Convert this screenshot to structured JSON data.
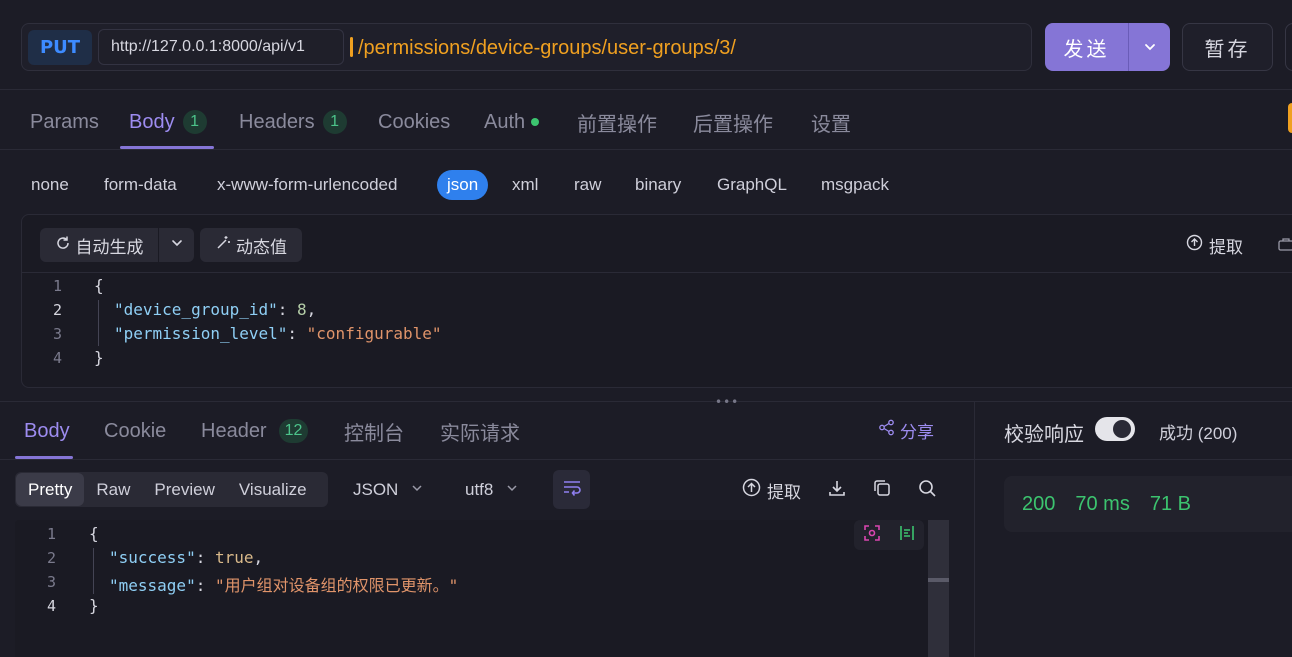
{
  "request": {
    "method": "PUT",
    "url_prefix": "http://127.0.0.1:8000/api/v1",
    "url_path": "/permissions/device-groups/user-groups/3/",
    "send_label": "发送",
    "save_label": "暂存"
  },
  "request_tabs": [
    {
      "label": "Params"
    },
    {
      "label": "Body",
      "badge": "1"
    },
    {
      "label": "Headers",
      "badge": "1"
    },
    {
      "label": "Cookies"
    },
    {
      "label": "Auth"
    },
    {
      "label": "前置操作"
    },
    {
      "label": "后置操作"
    },
    {
      "label": "设置"
    }
  ],
  "body_types": [
    "none",
    "form-data",
    "x-www-form-urlencoded",
    "json",
    "xml",
    "raw",
    "binary",
    "GraphQL",
    "msgpack"
  ],
  "editor_toolbar": {
    "auto_generate": "自动生成",
    "dynamic_value": "动态值",
    "extract": "提取"
  },
  "request_body": {
    "line_numbers": [
      "1",
      "2",
      "3",
      "4"
    ],
    "open": "{",
    "close": "}",
    "key1": "\"device_group_id\"",
    "val1": "8",
    "key2": "\"permission_level\"",
    "val2": "\"configurable\""
  },
  "response_tabs": [
    {
      "label": "Body"
    },
    {
      "label": "Cookie"
    },
    {
      "label": "Header",
      "badge": "12"
    },
    {
      "label": "控制台"
    },
    {
      "label": "实际请求"
    }
  ],
  "share_label": "分享",
  "view_modes": [
    "Pretty",
    "Raw",
    "Preview",
    "Visualize"
  ],
  "format_select": "JSON",
  "encoding_select": "utf8",
  "response_extract": "提取",
  "response_body": {
    "line_numbers": [
      "1",
      "2",
      "3",
      "4"
    ],
    "open": "{",
    "close": "}",
    "key1": "\"success\"",
    "val1": "true",
    "key2": "\"message\"",
    "val2": "\"用户组对设备组的权限已更新。\""
  },
  "verify": {
    "label": "校验响应",
    "status_text": "成功 (200)"
  },
  "response_status": {
    "code": "200",
    "time": "70 ms",
    "size": "71 B"
  },
  "colors": {
    "accent": "#8575d6",
    "method": "#3d8bff",
    "url_path": "#f0a020",
    "success": "#3cc46f"
  }
}
